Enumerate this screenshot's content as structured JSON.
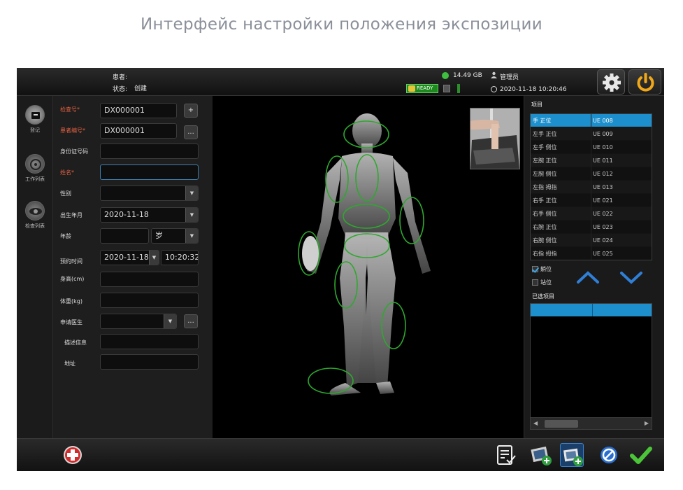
{
  "page_title": "Интерфейс настройки положения экспозиции",
  "topbar": {
    "patient_label": "患者:",
    "status_label": "状态:",
    "status_value": "创建",
    "disk_free": "14.49 GB",
    "user": "管理员",
    "ready_label": "READY",
    "datetime": "2020-11-18 10:20:46"
  },
  "nav": [
    {
      "label": "登记",
      "icon": "register-icon"
    },
    {
      "label": "工作列表",
      "icon": "worklist-icon"
    },
    {
      "label": "检查列表",
      "icon": "exam-list-icon"
    }
  ],
  "form": {
    "exam_no_label": "检查号*",
    "exam_no_value": "DX000001",
    "exam_no_btn": "+",
    "patient_no_label": "患者编号*",
    "patient_no_value": "DX000001",
    "patient_no_btn": "...",
    "id_label": "身份证号码",
    "id_value": "",
    "name_label": "姓名*",
    "name_value": "",
    "sex_label": "性别",
    "sex_value": "",
    "birth_label": "出生年月",
    "birth_value": "2020-11-18",
    "age_label": "年龄",
    "age_value": "",
    "age_unit": "岁",
    "appt_label": "预约时间",
    "appt_date": "2020-11-18",
    "appt_time": "10:20:32",
    "height_label": "身高(cm)",
    "height_value": "",
    "weight_label": "体重(kg)",
    "weight_value": "",
    "doctor_label": "申请医生",
    "doctor_value": "",
    "doctor_btn": "...",
    "desc_label": "描述信息",
    "desc_value": "",
    "addr_label": "地址",
    "addr_value": ""
  },
  "right": {
    "items_label": "项目",
    "items": [
      {
        "name": "手 正位",
        "code": "UE 008",
        "selected": true
      },
      {
        "name": "左手 正位",
        "code": "UE 009"
      },
      {
        "name": "左手 侧位",
        "code": "UE 010"
      },
      {
        "name": "左腕 正位",
        "code": "UE 011"
      },
      {
        "name": "左腕 侧位",
        "code": "UE 012"
      },
      {
        "name": "左指 拇指",
        "code": "UE 013"
      },
      {
        "name": "右手 正位",
        "code": "UE 021"
      },
      {
        "name": "右手 侧位",
        "code": "UE 022"
      },
      {
        "name": "右腕 正位",
        "code": "UE 023"
      },
      {
        "name": "右腕 侧位",
        "code": "UE 024"
      },
      {
        "name": "右指 拇指",
        "code": "UE 025"
      }
    ],
    "lying_label": "躺位",
    "lying_checked": true,
    "standing_label": "站位",
    "standing_checked": false,
    "selected_label": "已选项目"
  },
  "colors": {
    "accent": "#1d8fcc",
    "ok_green": "#3fbf3f",
    "region_outline": "#2ea82e",
    "required_label": "#e06040"
  }
}
